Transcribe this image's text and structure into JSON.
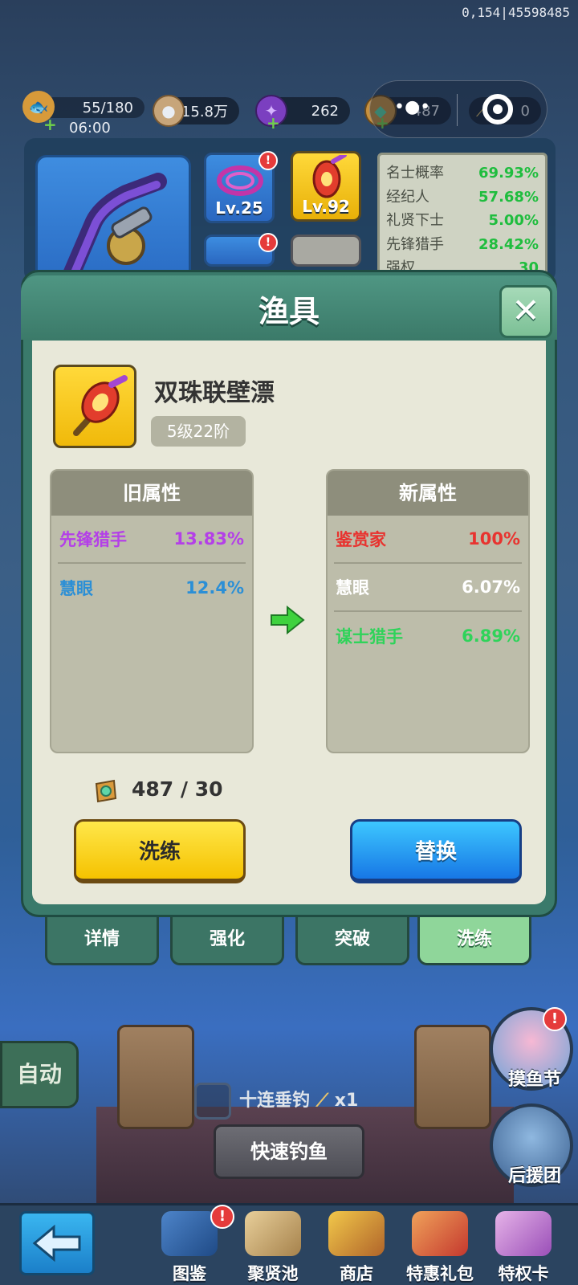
{
  "status": {
    "corner_id": "0,154|45598485"
  },
  "resources": [
    {
      "value": "55/180",
      "sub": "06:00",
      "icon": "fish-icon"
    },
    {
      "value": "15.8万",
      "icon": "coin-icon"
    },
    {
      "value": "262",
      "icon": "purple-gem-icon"
    },
    {
      "value": "487",
      "icon": "refine-stone-icon"
    },
    {
      "value": "0",
      "icon": "rod-ticket-icon"
    }
  ],
  "equipment": {
    "slots": [
      {
        "level": "Lv.25",
        "alert": "!"
      },
      {
        "level": "Lv.92"
      }
    ],
    "stats": [
      {
        "name": "名士概率",
        "value": "69.93%"
      },
      {
        "name": "经纪人",
        "value": "57.68%"
      },
      {
        "name": "礼贤下士",
        "value": "5.00%"
      },
      {
        "name": "先锋猎手",
        "value": "28.42%"
      },
      {
        "name": "强权",
        "value": "30"
      }
    ],
    "slot_alert_2": "!"
  },
  "modal": {
    "title": "渔具",
    "item_name": "双珠联壁漂",
    "item_level": "5级22阶",
    "old_panel": {
      "title": "旧属性",
      "rows": [
        {
          "name": "先锋猎手",
          "value": "13.83%",
          "color": "#b43fe8"
        },
        {
          "name": "慧眼",
          "value": "12.4%",
          "color": "#2b8fd6"
        }
      ]
    },
    "new_panel": {
      "title": "新属性",
      "rows": [
        {
          "name": "鉴赏家",
          "value": "100%",
          "color": "#e8332f"
        },
        {
          "name": "慧眼",
          "value": "6.07%",
          "color": "#ffffff"
        },
        {
          "name": "谋士猎手",
          "value": "6.89%",
          "color": "#2fd35a"
        }
      ]
    },
    "cost": "487 / 30",
    "refine_button": "洗练",
    "replace_button": "替换"
  },
  "tabs": [
    "详情",
    "强化",
    "突破",
    "洗练"
  ],
  "scene": {
    "auto_button": "自动",
    "ten_cast_label": "十连垂钓",
    "ten_cast_count": "x1",
    "quick_fish_button": "快速钓鱼",
    "fishing_festival_label": "摸鱼节",
    "fishing_festival_alert": "!",
    "support_group_label": "后援团"
  },
  "bottom_nav": {
    "items": [
      {
        "label": "图鉴",
        "alert": "!"
      },
      {
        "label": "聚贤池"
      },
      {
        "label": "商店"
      },
      {
        "label": "特惠礼包"
      },
      {
        "label": "特权卡"
      }
    ]
  }
}
